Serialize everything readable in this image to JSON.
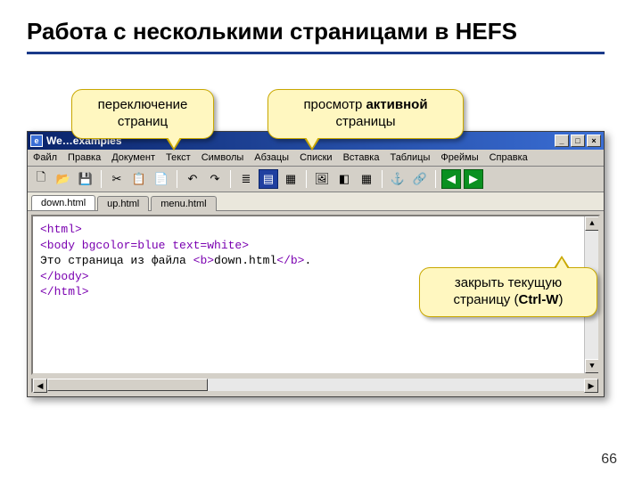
{
  "slide": {
    "title": "Работа с несколькими страницами в HEFS",
    "page_number": "66"
  },
  "callouts": {
    "switch_tabs": "переключение\nстраниц",
    "view_active_pre": "просмотр  ",
    "view_active_bold": "активной",
    "view_active_post": "\nстраницы",
    "close_current_pre": "закрыть текущую\nстраницу (",
    "close_current_bold": "Ctrl-W",
    "close_current_post": ")"
  },
  "window": {
    "title_prefix": "We",
    "title_suffix": "examples",
    "min_label": "_",
    "max_label": "□",
    "close_label": "×"
  },
  "menubar": {
    "items": [
      "Файл",
      "Правка",
      "Документ",
      "Текст",
      "Символы",
      "Абзацы",
      "Списки",
      "Вставка",
      "Таблицы",
      "Фреймы",
      "Справка"
    ]
  },
  "toolbar": {
    "items": [
      {
        "name": "new-icon",
        "glyph": "🗋",
        "interact": true
      },
      {
        "name": "open-icon",
        "glyph": "📂",
        "interact": true
      },
      {
        "name": "save-icon",
        "glyph": "💾",
        "interact": true
      },
      {
        "sep": true
      },
      {
        "name": "cut-icon",
        "glyph": "✂",
        "interact": true
      },
      {
        "name": "copy-icon",
        "glyph": "📋",
        "interact": true
      },
      {
        "name": "paste-icon",
        "glyph": "📄",
        "interact": true
      },
      {
        "sep": true
      },
      {
        "name": "undo-icon",
        "glyph": "↶",
        "interact": true
      },
      {
        "name": "redo-icon",
        "glyph": "↷",
        "interact": true
      },
      {
        "sep": true
      },
      {
        "name": "list-icon",
        "glyph": "≣",
        "interact": true
      },
      {
        "name": "view-edit-icon",
        "glyph": "▤",
        "interact": true,
        "cls": "blue"
      },
      {
        "name": "view-source-icon",
        "glyph": "▦",
        "interact": true
      },
      {
        "sep": true
      },
      {
        "name": "image-icon",
        "glyph": "🖼",
        "interact": true
      },
      {
        "name": "color-icon",
        "glyph": "◧",
        "interact": true
      },
      {
        "name": "multimedia-icon",
        "glyph": "▦",
        "interact": true
      },
      {
        "sep": true
      },
      {
        "name": "anchor-icon",
        "glyph": "⚓",
        "interact": true
      },
      {
        "name": "link-icon",
        "glyph": "🔗",
        "interact": true
      },
      {
        "sep": true
      },
      {
        "name": "back-icon",
        "glyph": "◀",
        "interact": true,
        "cls": "green"
      },
      {
        "name": "forward-icon",
        "glyph": "▶",
        "interact": true,
        "cls": "green"
      }
    ]
  },
  "tabs": [
    {
      "label": "down.html",
      "active": true
    },
    {
      "label": "up.html",
      "active": false
    },
    {
      "label": "menu.html",
      "active": false
    }
  ],
  "code": {
    "l1": "<html>",
    "l2": "<body bgcolor=blue text=white>",
    "l3a": "Это страница из файла ",
    "l3b": "<b>",
    "l3c": "down.html",
    "l3d": "</b>",
    "l3e": ".",
    "l4": "</body>",
    "l5": "</html>"
  }
}
